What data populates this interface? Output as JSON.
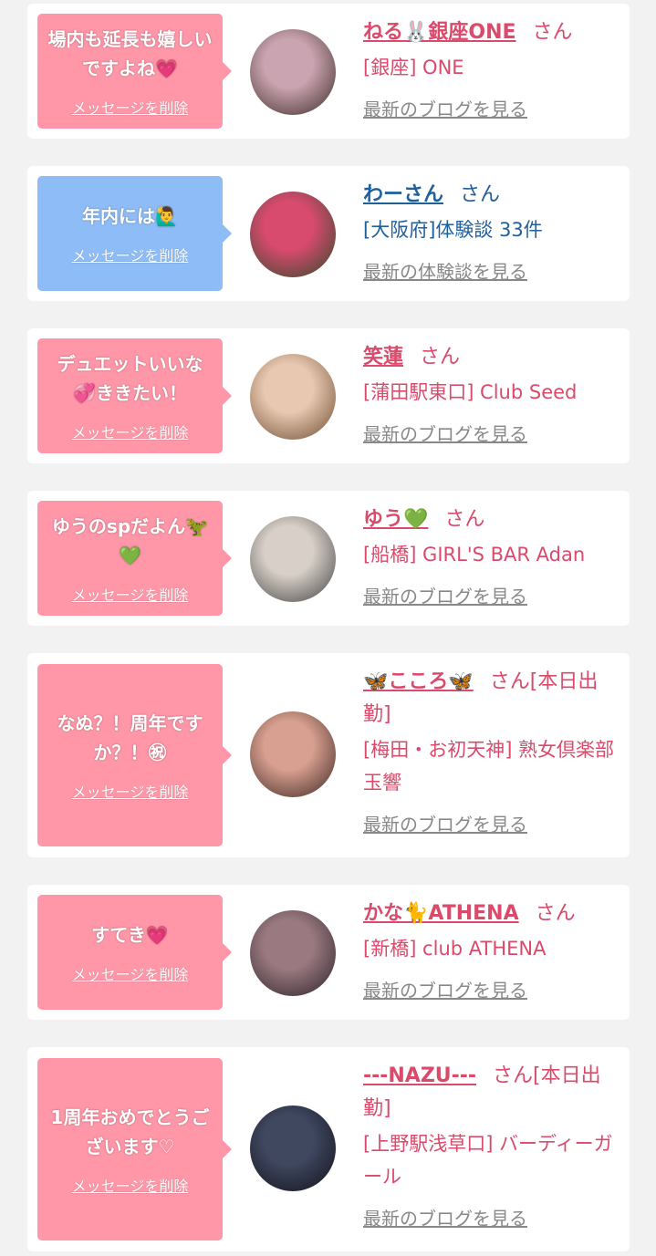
{
  "theme": {
    "pink": "#ff97a8",
    "blue": "#8ebcf6",
    "name_pink": "#d94a6b",
    "name_blue": "#1f5f9c",
    "link_gray": "#888888"
  },
  "cards": [
    {
      "message": "場内も延長も嬉しいですよね💗",
      "delete_label": "メッセージを削除",
      "name": "ねる🐰銀座ONE",
      "suffix": "さん",
      "shop": "[銀座] ONE",
      "link": "最新のブログを見る",
      "bubble": "pink",
      "avatar_colors": [
        "#caa4b0",
        "#3a2a26"
      ]
    },
    {
      "message": "年内には🙋‍♂️",
      "delete_label": "メッセージを削除",
      "name": "わーさん",
      "suffix": "さん",
      "shop": "[大阪府]体験談 33件",
      "link": "最新の体験談を見る",
      "bubble": "blue",
      "avatar_colors": [
        "#d84a6e",
        "#2e4a2a"
      ]
    },
    {
      "message": "デュエットいいな💞ききたい！",
      "delete_label": "メッセージを削除",
      "name": "笑蓮",
      "suffix": "さん",
      "shop": "[蒲田駅東口] Club Seed",
      "link": "最新のブログを見る",
      "bubble": "pink",
      "avatar_colors": [
        "#e8c8b0",
        "#6b4a30"
      ]
    },
    {
      "message": "ゆうのspだよん🦖💚",
      "delete_label": "メッセージを削除",
      "name": "ゆう💚",
      "suffix": "さん",
      "shop": "[船橋] GIRL'S BAR Adan",
      "link": "最新のブログを見る",
      "bubble": "pink",
      "avatar_colors": [
        "#d8d0c8",
        "#404040"
      ]
    },
    {
      "message": "なぬ？！周年ですか？！㊗",
      "delete_label": "メッセージを削除",
      "name": "🦋こころ🦋",
      "suffix": "さん[本日出勤]",
      "shop": "[梅田・お初天神] 熟女倶楽部 玉響",
      "link": "最新のブログを見る",
      "bubble": "pink",
      "avatar_colors": [
        "#d8a090",
        "#3a2420"
      ]
    },
    {
      "message": "すてき💗",
      "delete_label": "メッセージを削除",
      "name": "かな🐈ATHENA",
      "suffix": "さん",
      "shop": "[新橋] club ATHENA",
      "link": "最新のブログを見る",
      "bubble": "pink",
      "avatar_colors": [
        "#9a7a80",
        "#2a2228"
      ]
    },
    {
      "message": "1周年おめでとうございます♡",
      "delete_label": "メッセージを削除",
      "name": "---NAZU---",
      "suffix": "さん[本日出勤]",
      "shop": "[上野駅浅草口] バーディーガール",
      "link": "最新のブログを見る",
      "bubble": "pink",
      "avatar_colors": [
        "#404860",
        "#101018"
      ]
    }
  ]
}
